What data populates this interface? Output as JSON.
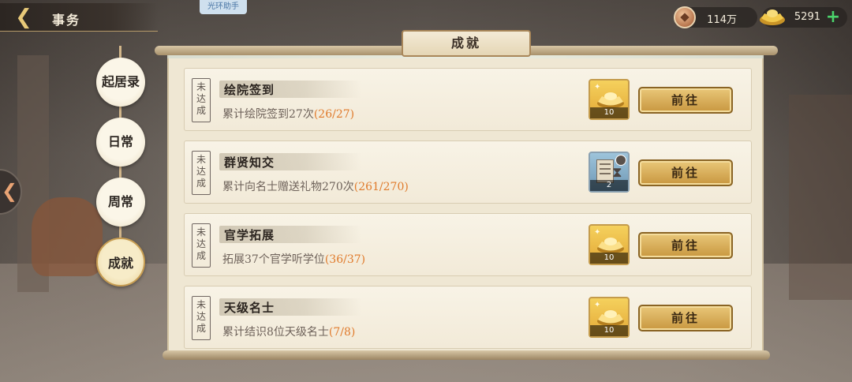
{
  "header": {
    "title": "事务",
    "helper_tag": "光环助手",
    "copper": "114万",
    "gold": "5291"
  },
  "tabs": [
    {
      "label": "起居录",
      "active": false
    },
    {
      "label": "日常",
      "active": false
    },
    {
      "label": "周常",
      "active": false
    },
    {
      "label": "成就",
      "active": true
    }
  ],
  "panel": {
    "title": "成就"
  },
  "tasks": [
    {
      "status": [
        "未",
        "达",
        "成"
      ],
      "name": "绘院签到",
      "desc": "累计绘院签到27次",
      "progress": "(26/27)",
      "reward_icon": "gold-ingot-icon",
      "reward_count": "10",
      "button": "前往"
    },
    {
      "status": [
        "未",
        "达",
        "成"
      ],
      "name": "群贤知交",
      "desc": "累计向名士赠送礼物270次",
      "progress": "(261/270)",
      "reward_icon": "speedup-scroll-icon",
      "reward_count": "2",
      "button": "前往"
    },
    {
      "status": [
        "未",
        "达",
        "成"
      ],
      "name": "官学拓展",
      "desc": "拓展37个官学听学位",
      "progress": "(36/37)",
      "reward_icon": "gold-ingot-icon",
      "reward_count": "10",
      "button": "前往"
    },
    {
      "status": [
        "未",
        "达",
        "成"
      ],
      "name": "天级名士",
      "desc": "累计结识8位天级名士",
      "progress": "(7/8)",
      "reward_icon": "gold-ingot-icon",
      "reward_count": "10",
      "button": "前往"
    }
  ],
  "colors": {
    "progress": "#e07b2c",
    "button": "#d8b05a",
    "accent_plus": "#4bd36b"
  }
}
